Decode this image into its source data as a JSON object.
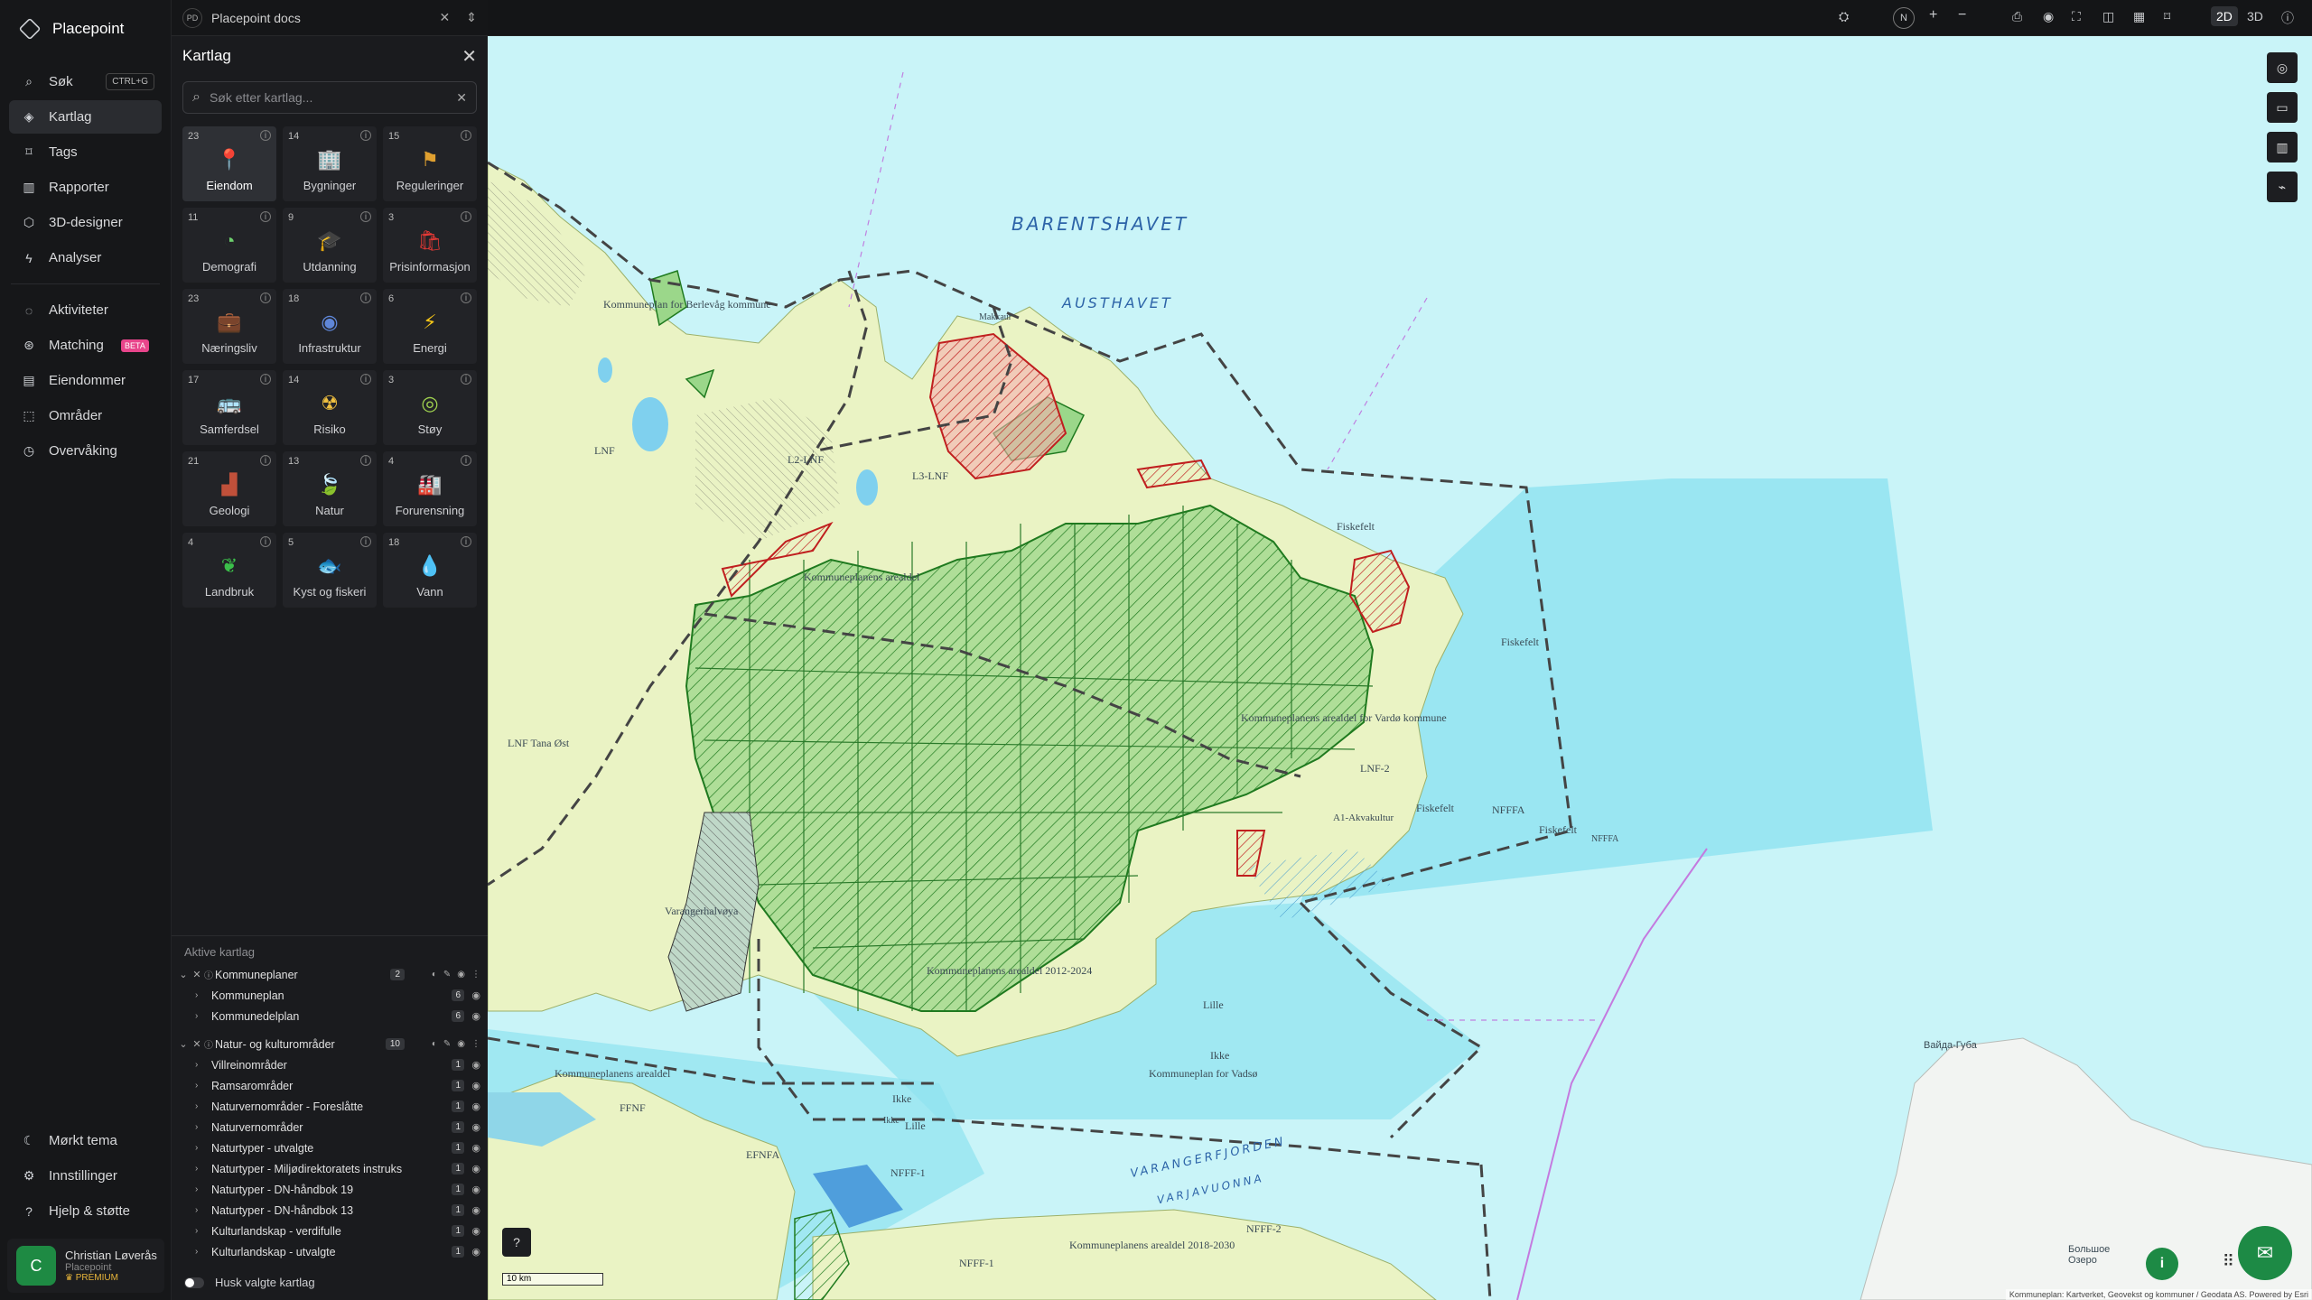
{
  "app": {
    "name": "Placepoint",
    "tab_badge": "PD",
    "tab_title": "Placepoint docs"
  },
  "nav": {
    "items": [
      {
        "label": "Søk",
        "shortcut": "CTRL+G",
        "icon": "search-icon"
      },
      {
        "label": "Kartlag",
        "icon": "layers-icon"
      },
      {
        "label": "Tags",
        "icon": "bookmark-icon"
      },
      {
        "label": "Rapporter",
        "icon": "chart-icon"
      },
      {
        "label": "3D-designer",
        "icon": "cube-icon"
      },
      {
        "label": "Analyser",
        "icon": "bolt-icon"
      }
    ],
    "items2": [
      {
        "label": "Aktiviteter",
        "icon": "chat-icon"
      },
      {
        "label": "Matching",
        "badge": "BETA",
        "icon": "match-icon"
      },
      {
        "label": "Eiendommer",
        "icon": "building-icon"
      },
      {
        "label": "Områder",
        "icon": "area-icon"
      },
      {
        "label": "Overvåking",
        "icon": "monitor-icon"
      }
    ],
    "bottom": [
      {
        "label": "Mørkt tema",
        "icon": "moon-icon"
      },
      {
        "label": "Innstillinger",
        "icon": "gear-icon"
      },
      {
        "label": "Hjelp & støtte",
        "icon": "help-icon"
      }
    ],
    "user": {
      "initial": "C",
      "name": "Christian Løverås",
      "org": "Placepoint",
      "tier": "PREMIUM"
    }
  },
  "panel": {
    "title": "Kartlag",
    "search_placeholder": "Søk etter kartlag...",
    "tiles": [
      {
        "count": "23",
        "label": "Eiendom",
        "icon": "pin-icon",
        "selected": true
      },
      {
        "count": "14",
        "label": "Bygninger",
        "icon": "building-icon"
      },
      {
        "count": "15",
        "label": "Reguleringer",
        "icon": "signpost-icon"
      },
      {
        "count": "11",
        "label": "Demografi",
        "icon": "demography-icon"
      },
      {
        "count": "9",
        "label": "Utdanning",
        "icon": "graduation-icon"
      },
      {
        "count": "3",
        "label": "Prisinformasjon",
        "icon": "price-icon"
      },
      {
        "count": "23",
        "label": "Næringsliv",
        "icon": "briefcase-icon"
      },
      {
        "count": "18",
        "label": "Infrastruktur",
        "icon": "network-icon"
      },
      {
        "count": "6",
        "label": "Energi",
        "icon": "lightning-icon"
      },
      {
        "count": "17",
        "label": "Samferdsel",
        "icon": "bus-icon"
      },
      {
        "count": "14",
        "label": "Risiko",
        "icon": "risk-icon"
      },
      {
        "count": "3",
        "label": "Støy",
        "icon": "noise-icon"
      },
      {
        "count": "21",
        "label": "Geologi",
        "icon": "geology-icon"
      },
      {
        "count": "13",
        "label": "Natur",
        "icon": "leaf-icon"
      },
      {
        "count": "4",
        "label": "Forurensning",
        "icon": "factory-icon"
      },
      {
        "count": "4",
        "label": "Landbruk",
        "icon": "sprout-icon"
      },
      {
        "count": "5",
        "label": "Kyst og fiskeri",
        "icon": "fish-icon"
      },
      {
        "count": "18",
        "label": "Vann",
        "icon": "drop-icon"
      }
    ],
    "active_title": "Aktive kartlag",
    "groups": [
      {
        "name": "Kommuneplaner",
        "count": "2",
        "rows": [
          {
            "name": "Kommuneplan",
            "count": "6"
          },
          {
            "name": "Kommunedelplan",
            "count": "6"
          }
        ]
      },
      {
        "name": "Natur- og kulturområder",
        "count": "10",
        "rows": [
          {
            "name": "Villreinområder",
            "count": "1"
          },
          {
            "name": "Ramsarområder",
            "count": "1"
          },
          {
            "name": "Naturvernområder - Foreslåtte",
            "count": "1"
          },
          {
            "name": "Naturvernområder",
            "count": "1"
          },
          {
            "name": "Naturtyper - utvalgte",
            "count": "1"
          },
          {
            "name": "Naturtyper - Miljødirektoratets instruks",
            "count": "1"
          },
          {
            "name": "Naturtyper - DN-håndbok 19",
            "count": "1"
          },
          {
            "name": "Naturtyper - DN-håndbok 13",
            "count": "1"
          },
          {
            "name": "Kulturlandskap - verdifulle",
            "count": "1"
          },
          {
            "name": "Kulturlandskap - utvalgte",
            "count": "1"
          }
        ]
      }
    ],
    "remember_label": "Husk valgte kartlag"
  },
  "toolbar": {
    "compass": "N",
    "plus": "+",
    "minus": "−",
    "mode_2d": "2D",
    "mode_3d": "3D"
  },
  "map": {
    "sea_labels": [
      "BARENTSHAVET",
      "AUSTHAVET",
      "VARANGERFJORDEN",
      "VARJAVUONNA"
    ],
    "labels": [
      "Kommuneplan for Berlevåg kommune",
      "LNF",
      "L2-LNF",
      "L3-LNF",
      "Kommuneplanens arealdel",
      "Makkaur",
      "Fiskefelt",
      "Fiskefelt",
      "Fiskefelt",
      "Fiskefelt",
      "NFFFA",
      "NFFFA",
      "Kommuneplanens arealdel for Vardø kommune",
      "LNF-2",
      "LNF Tana Øst",
      "Varangerhalvøya",
      "Kommuneplanens arealdel 2012-2024",
      "Lille",
      "Ikke",
      "Ikke",
      "Lille",
      "Ikke",
      "Kommuneplan for Vadsø",
      "Kommuneplanens arealdel",
      "FFNF",
      "NFFF-1",
      "NFFF-1",
      "NFFF-2",
      "Kommuneplanens arealdel 2018-2030",
      "EFNFA",
      "Вайда-Губа",
      "Большое Озеро",
      "A1-Akvakultur"
    ],
    "scale": "10 km",
    "attribution": "Kommuneplan: Kartverket, Geovekst og kommuner / Geodata AS. Powered by Esri",
    "colors": {
      "sea": "#bff0f6",
      "land": "#ecf3c8",
      "protected": "#8fd07a",
      "hatch": "#1f7a1f",
      "red": "#d23232"
    }
  }
}
